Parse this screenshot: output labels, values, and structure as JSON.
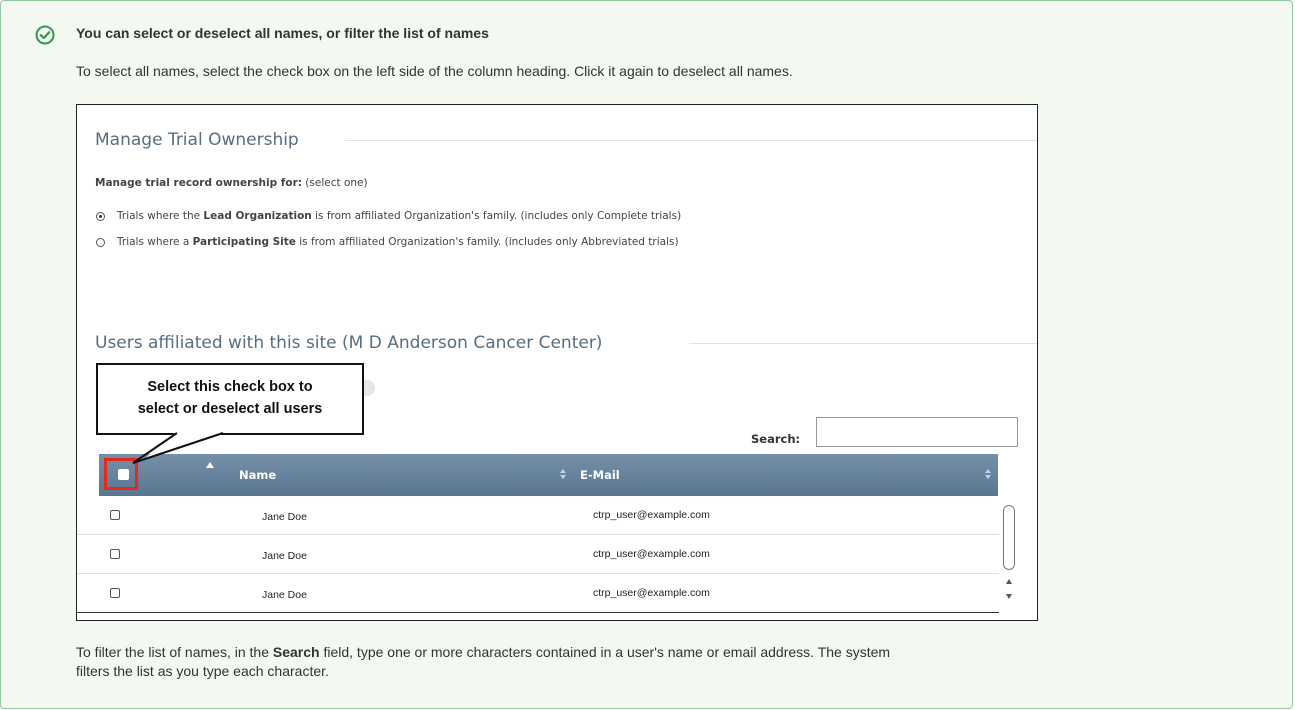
{
  "tip": {
    "title": "You can select or deselect all names, or filter the list of names",
    "intro": "To select all names, select the check box on the left side of the column heading. Click it again to deselect all names.",
    "footer_before": "To filter the list of names, in the ",
    "footer_bold": "Search",
    "footer_after_line1": " field, type one or more characters contained in a user's name or email address. The system",
    "footer_line2": "filters the list as you type each character.",
    "icon": "check-circle-icon",
    "accent": "#2e9c4f"
  },
  "screenshot": {
    "section1_title": "Manage Trial Ownership",
    "prompt_bold": "Manage trial record ownership for:",
    "prompt_rest": " (select one)",
    "option1_pre": "Trials where the ",
    "option1_bold": "Lead Organization",
    "option1_post": " is from affiliated Organization's family. (includes only Complete trials)",
    "option2_pre": "Trials where a ",
    "option2_bold": "Participating Site",
    "option2_post": " is from affiliated Organization's family. (includes only Abbreviated trials)",
    "selected_option": 1,
    "section2_title": "Users affiliated with this site (M D Anderson Cancer Center)",
    "search_label": "Search:",
    "search_value": "",
    "callout_line1": "Select this check box to",
    "callout_line2": "select or deselect all users",
    "columns": [
      "Name",
      "E-Mail"
    ],
    "rows": [
      {
        "name": "Jane Doe",
        "email": "ctrp_user@example.com"
      },
      {
        "name": "Jane Doe",
        "email": "ctrp_user@example.com"
      },
      {
        "name": "Jane Doe",
        "email": "ctrp_user@example.com"
      }
    ],
    "colors": {
      "header": "#627d96",
      "highlight": "#e22b1c",
      "title": "#566d82"
    }
  }
}
